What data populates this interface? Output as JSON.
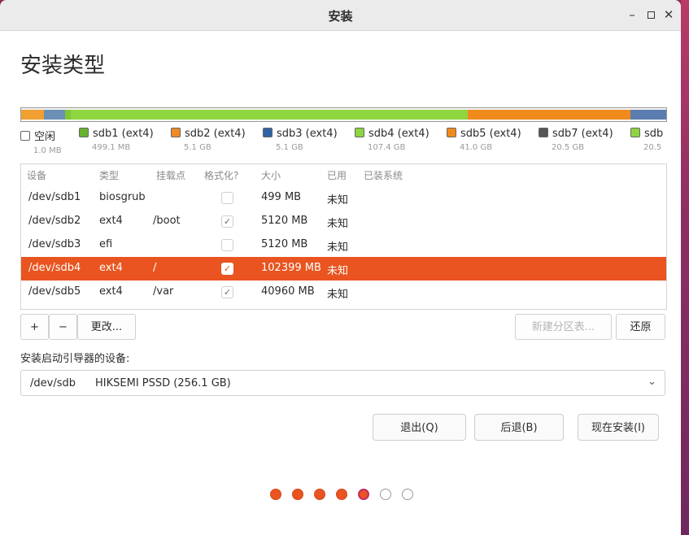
{
  "window": {
    "title": "安装"
  },
  "page": {
    "title": "安装类型"
  },
  "partition_bar": {
    "segments": [
      {
        "name": "free",
        "start": 0.0,
        "width": 0.035,
        "color": "#f0a030"
      },
      {
        "name": "sdb1",
        "start": 0.035,
        "width": 0.033,
        "color": "#6b8fb5"
      },
      {
        "name": "sdb2",
        "start": 0.068,
        "width": 0.009,
        "color": "#7ec832"
      },
      {
        "name": "sdb4",
        "start": 0.077,
        "width": 0.615,
        "color": "#8ed640"
      },
      {
        "name": "sdb5",
        "start": 0.692,
        "width": 0.252,
        "color": "#f08a1c"
      },
      {
        "name": "sdb7",
        "start": 0.944,
        "width": 0.056,
        "color": "#5b7db0"
      }
    ]
  },
  "legend": [
    {
      "label": "空闲",
      "size": "1.0 MB",
      "color": "#ffffff"
    },
    {
      "label": "sdb1 (ext4)",
      "size": "499.1 MB",
      "color": "#66b32e"
    },
    {
      "label": "sdb2 (ext4)",
      "size": "5.1 GB",
      "color": "#f08a24"
    },
    {
      "label": "sdb3 (ext4)",
      "size": "5.1 GB",
      "color": "#2f64a3"
    },
    {
      "label": "sdb4 (ext4)",
      "size": "107.4 GB",
      "color": "#8ed640"
    },
    {
      "label": "sdb5 (ext4)",
      "size": "41.0 GB",
      "color": "#f08a1c"
    },
    {
      "label": "sdb7 (ext4)",
      "size": "20.5 GB",
      "color": "#555555"
    },
    {
      "label": "sdb",
      "size": "20.5",
      "color": "#8ed640"
    }
  ],
  "table": {
    "columns": [
      "设备",
      "类型",
      "挂载点",
      "格式化?",
      "大小",
      "已用",
      "已装系统"
    ],
    "rows": [
      {
        "device": "/dev/sdb1",
        "type": "biosgrub",
        "mount": "",
        "format": "",
        "size": "499 MB",
        "used": "未知",
        "selected": false
      },
      {
        "device": "/dev/sdb2",
        "type": "ext4",
        "mount": "/boot",
        "format": "✓",
        "size": "5120 MB",
        "used": "未知",
        "selected": false
      },
      {
        "device": "/dev/sdb3",
        "type": "efi",
        "mount": "",
        "format": "",
        "size": "5120 MB",
        "used": "未知",
        "selected": false
      },
      {
        "device": "/dev/sdb4",
        "type": "ext4",
        "mount": "/",
        "format": "✓",
        "size": "102399 MB",
        "used": "未知",
        "selected": true
      },
      {
        "device": "/dev/sdb5",
        "type": "ext4",
        "mount": "/var",
        "format": "✓",
        "size": "40960 MB",
        "used": "未知",
        "selected": false
      }
    ]
  },
  "toolbar": {
    "add_label": "+",
    "remove_label": "−",
    "change_label": "更改...",
    "new_table_label": "新建分区表...",
    "revert_label": "还原"
  },
  "bootloader": {
    "label": "安装启动引导器的设备:",
    "device": "/dev/sdb",
    "model": "HIKSEMI PSSD (256.1 GB)"
  },
  "nav": {
    "quit_label": "退出(Q)",
    "back_label": "后退(B)",
    "install_label": "现在安装(I)"
  },
  "progress_dots": [
    {
      "state": "done",
      "color": "#e95420"
    },
    {
      "state": "done",
      "color": "#e95420"
    },
    {
      "state": "done",
      "color": "#e95420"
    },
    {
      "state": "done",
      "color": "#e95420"
    },
    {
      "state": "current",
      "color": "#e95420"
    },
    {
      "state": "pending",
      "color": "#ffffff"
    },
    {
      "state": "pending",
      "color": "#ffffff"
    }
  ]
}
